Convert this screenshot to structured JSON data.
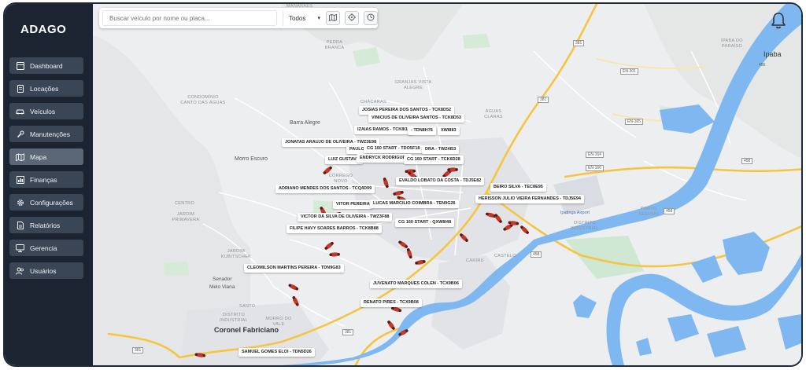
{
  "brand": {
    "logo_text": "ADAGO"
  },
  "sidebar": {
    "items": [
      {
        "label": "Dashboard",
        "icon": "dashboard-icon"
      },
      {
        "label": "Locações",
        "icon": "document-icon"
      },
      {
        "label": "Veículos",
        "icon": "car-icon"
      },
      {
        "label": "Manutenções",
        "icon": "wrench-icon"
      },
      {
        "label": "Mapa",
        "icon": "map-icon",
        "active": true
      },
      {
        "label": "Finanças",
        "icon": "chart-icon"
      },
      {
        "label": "Configurações",
        "icon": "gear-icon"
      },
      {
        "label": "Relatórios",
        "icon": "report-icon"
      },
      {
        "label": "Gerencia",
        "icon": "monitor-icon"
      },
      {
        "label": "Usuários",
        "icon": "users-icon"
      }
    ]
  },
  "search": {
    "placeholder": "Buscar veículo por nome ou placa...",
    "filter_value": "Todos",
    "tools": [
      "map-layers-icon",
      "crosshair-icon",
      "clock-icon"
    ]
  },
  "header": {
    "bell_icon": "bell-icon"
  },
  "colors": {
    "sidebar": "#1c2431",
    "nav_item": "#3a4556",
    "water": "#7fb8f0",
    "road_major": "#f5c542",
    "marker": "#c1392b"
  },
  "map": {
    "places": {
      "barra_alegre": "Barra Alegre",
      "morro_escuro": "Morro Escuro",
      "ipaba": "Ipaba",
      "coronel_fabriciano": "Coronel Fabriciano",
      "senador": "Senador",
      "melo_viana": "Melo Viana",
      "ipatinga_airport": "Ipatinga Airport",
      "centro": "CENTRO",
      "jardim_primavera": "JARDIM PRIMAVERA",
      "distrito_industrial": "DISTRITO INDUSTRIAL",
      "porto_seguro": "PORTO SEGURO",
      "caririu": "CARIRU",
      "castelo": "CASTELO",
      "chacaras": "CHÁCARAS",
      "granjas_vista_alegre": "GRANJAS VISTA ALEGRE",
      "aguas_claras": "ÁGUAS CLARAS",
      "condominio_canto_aguas": "CONDOMÍNIO CANTO DAS ÁGUAS",
      "pedra_branca": "PEDRA BRANCA",
      "ipaba_do_paraiso": "IPABA DO PARAÍSO",
      "distrito_industrial_2": "DISTRITO INDUSTRIAL",
      "manaraes": "MANARAES",
      "corrego_novo": "CÓRREGO NOVO",
      "jardim_kubitschek": "JARDIM KUBITSCHEK",
      "morro_do_vale": "MORRO DO VALE",
      "santo": "SANTO"
    },
    "road_badges": [
      "381",
      "EN-301",
      "EN-165",
      "EN-160",
      "458",
      "381",
      "458",
      "458",
      "381",
      "381",
      "456",
      "EN-164"
    ],
    "vehicle_labels": [
      "JOSIAS PEREIRA DOS SANTOS - TCK8D52",
      "VINICIUS DE OLIVEIRA SANTOS - TCK8D53",
      "IZAIAS RAMOS - TCK8I14",
      "- TDN8H76",
      "XW8I83",
      "JONATAS ARAUJO DE OLIVEIRA - TWZ3E98",
      "PAULO",
      "CG 160 START - TDO5F18",
      "DRA - TWZ4I53",
      "LUIZ GUSTAVO",
      "ENDRYCK RODRIGUES",
      "CG 160 START - TCK6D28",
      "ADRIANO MENDES DOS SANTOS - TCQ4D99",
      "EVALDO LOBATO DA COSTA - TDJ5E82",
      "BEIRO SILVA - TEC8E95",
      "HERISSON JULIO VIEIRA FERNANDES - TDJ5E94",
      "VITOR PEREIRA",
      "LUCAS MARCILIO COIMBRA - TEN9G26",
      "VICTOR DA SILVA DE OLIVEIRA - TWZ3F88",
      "CG 160 START - QXW8I48",
      "FILIPE HAVY SOARES BARROS - TCK8B88",
      "CLEOMILSON MARTINS PEREIRA - TDN9G83",
      "JUVENATO MARQUES COLEN - TCX9B06",
      "RENATO PIRES - TCX9B08",
      "SAMUEL GOMES ELOI - TDN5D26"
    ]
  }
}
